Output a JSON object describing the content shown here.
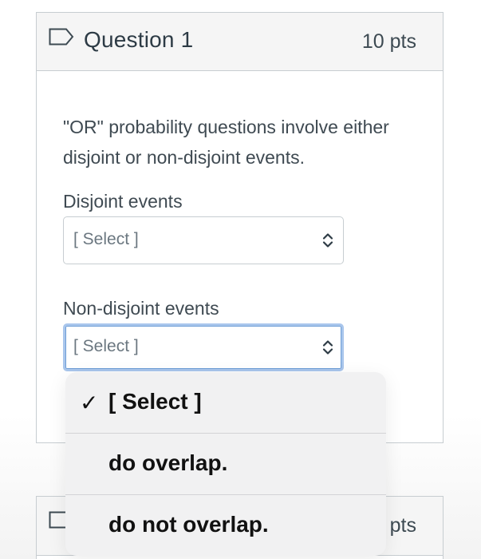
{
  "questions": [
    {
      "title": "Question 1",
      "points": "10 pts",
      "prompt": "\"OR\" probability questions involve either disjoint or non-disjoint events.",
      "fields": [
        {
          "label": "Disjoint events",
          "selected": "[ Select ]"
        },
        {
          "label": "Non-disjoint events",
          "selected": "[ Select ]"
        }
      ]
    },
    {
      "points": "pts"
    }
  ],
  "dropdown": {
    "options": [
      "[ Select ]",
      "do overlap.",
      "do not overlap."
    ],
    "checked_index": 0,
    "check_glyph": "✓"
  },
  "icons": {
    "question": "flag-outline-icon",
    "select": "sort-arrows-icon",
    "checked": "checkmark-icon"
  },
  "colors": {
    "focus_ring": "#a9c6ec",
    "border": "#c7cdd1",
    "header_bg": "#f5f5f5",
    "menu_bg": "#f1f1f2"
  }
}
